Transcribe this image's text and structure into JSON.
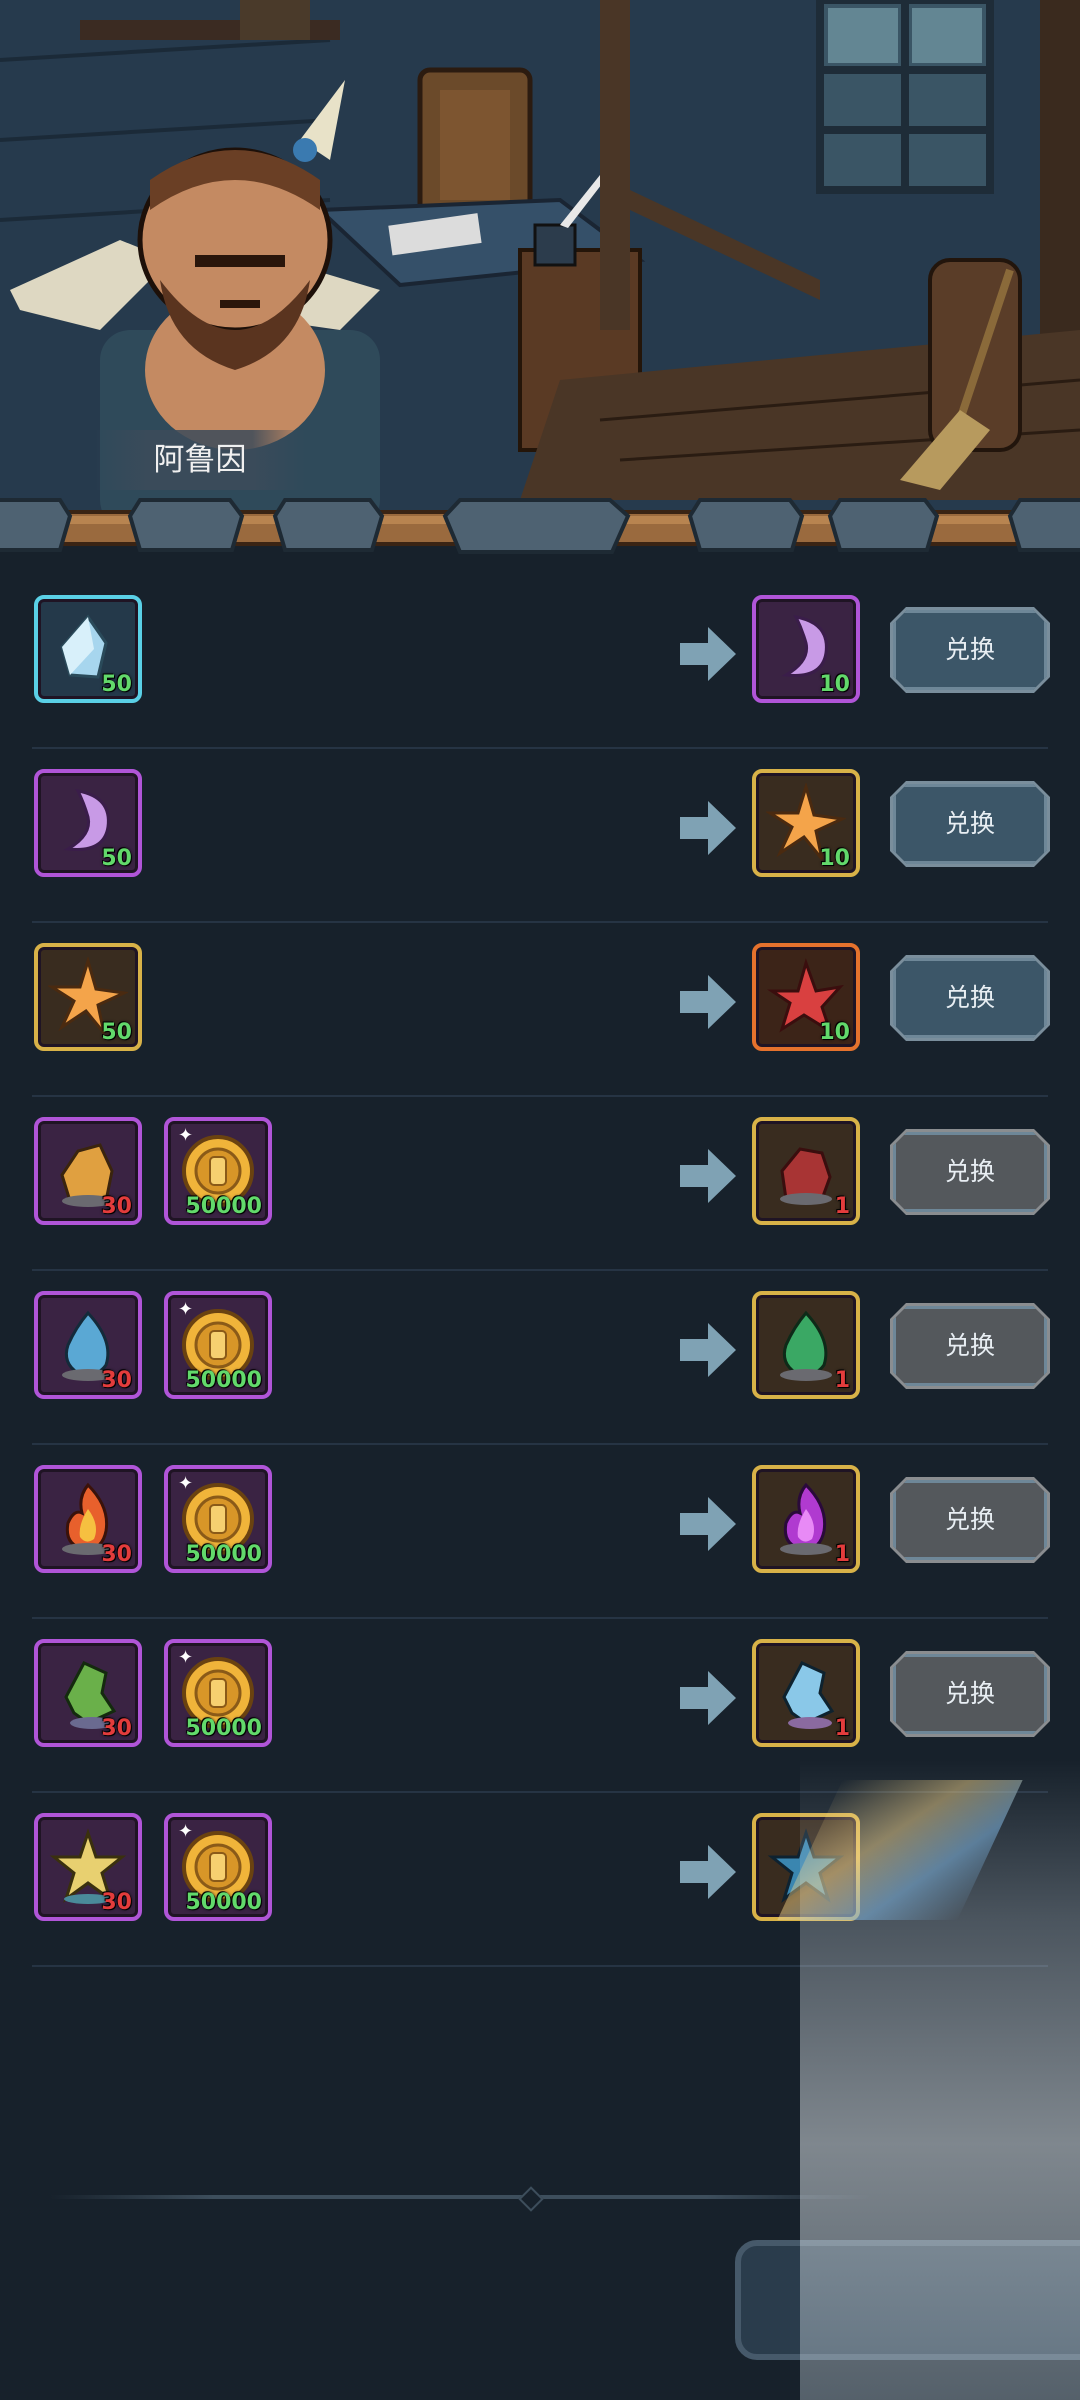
{
  "npc": {
    "name": "阿鲁因"
  },
  "exchange_button_label": "兑换",
  "rows": [
    {
      "inputs": [
        {
          "item": "light-blue-crystal",
          "qty": "50",
          "frame": "blue"
        }
      ],
      "output": {
        "item": "purple-crystal",
        "qty": "10",
        "frame": "purple"
      },
      "state": "active"
    },
    {
      "inputs": [
        {
          "item": "purple-crystal",
          "qty": "50",
          "frame": "purple"
        }
      ],
      "output": {
        "item": "orange-star-crystal",
        "qty": "10",
        "frame": "gold"
      },
      "state": "active"
    },
    {
      "inputs": [
        {
          "item": "orange-star-crystal",
          "qty": "50",
          "frame": "gold"
        }
      ],
      "output": {
        "item": "red-crystal",
        "qty": "10",
        "frame": "orange"
      },
      "state": "active"
    },
    {
      "inputs": [
        {
          "item": "yellow-ore",
          "qty": "30",
          "frame": "purple",
          "qty_color": "red"
        },
        {
          "item": "gold-coin",
          "qty": "50000",
          "frame": "purple"
        }
      ],
      "output": {
        "item": "red-ore",
        "qty": "1",
        "frame": "gold",
        "qty_color": "red"
      },
      "state": "disabled"
    },
    {
      "inputs": [
        {
          "item": "blue-ore",
          "qty": "30",
          "frame": "purple",
          "qty_color": "red"
        },
        {
          "item": "gold-coin",
          "qty": "50000",
          "frame": "purple"
        }
      ],
      "output": {
        "item": "green-ore",
        "qty": "1",
        "frame": "gold",
        "qty_color": "red"
      },
      "state": "disabled"
    },
    {
      "inputs": [
        {
          "item": "fire-ore",
          "qty": "30",
          "frame": "purple",
          "qty_color": "red"
        },
        {
          "item": "gold-coin",
          "qty": "50000",
          "frame": "purple"
        }
      ],
      "output": {
        "item": "purple-fire-ore",
        "qty": "1",
        "frame": "gold",
        "qty_color": "red"
      },
      "state": "disabled"
    },
    {
      "inputs": [
        {
          "item": "green-shard-ore",
          "qty": "30",
          "frame": "purple",
          "qty_color": "red"
        },
        {
          "item": "gold-coin",
          "qty": "50000",
          "frame": "purple"
        }
      ],
      "output": {
        "item": "blue-shard-ore",
        "qty": "1",
        "frame": "gold",
        "qty_color": "red"
      },
      "state": "disabled"
    },
    {
      "inputs": [
        {
          "item": "yellow-star-ore",
          "qty": "30",
          "frame": "purple",
          "qty_color": "red"
        },
        {
          "item": "gold-coin",
          "qty": "50000",
          "frame": "purple"
        }
      ],
      "output": {
        "item": "blue-star-ore",
        "qty": "",
        "frame": "gold"
      },
      "state": "hidden"
    }
  ],
  "colors": {
    "background": "#17212b",
    "button_active": "#3c5668",
    "button_disabled": "#54585c",
    "frame_purple": "#b055d8",
    "frame_gold": "#d8b248",
    "frame_blue": "#5ad0e6",
    "frame_orange": "#e5722d",
    "qty_green": "#62d96b",
    "qty_red": "#e33c3c"
  }
}
